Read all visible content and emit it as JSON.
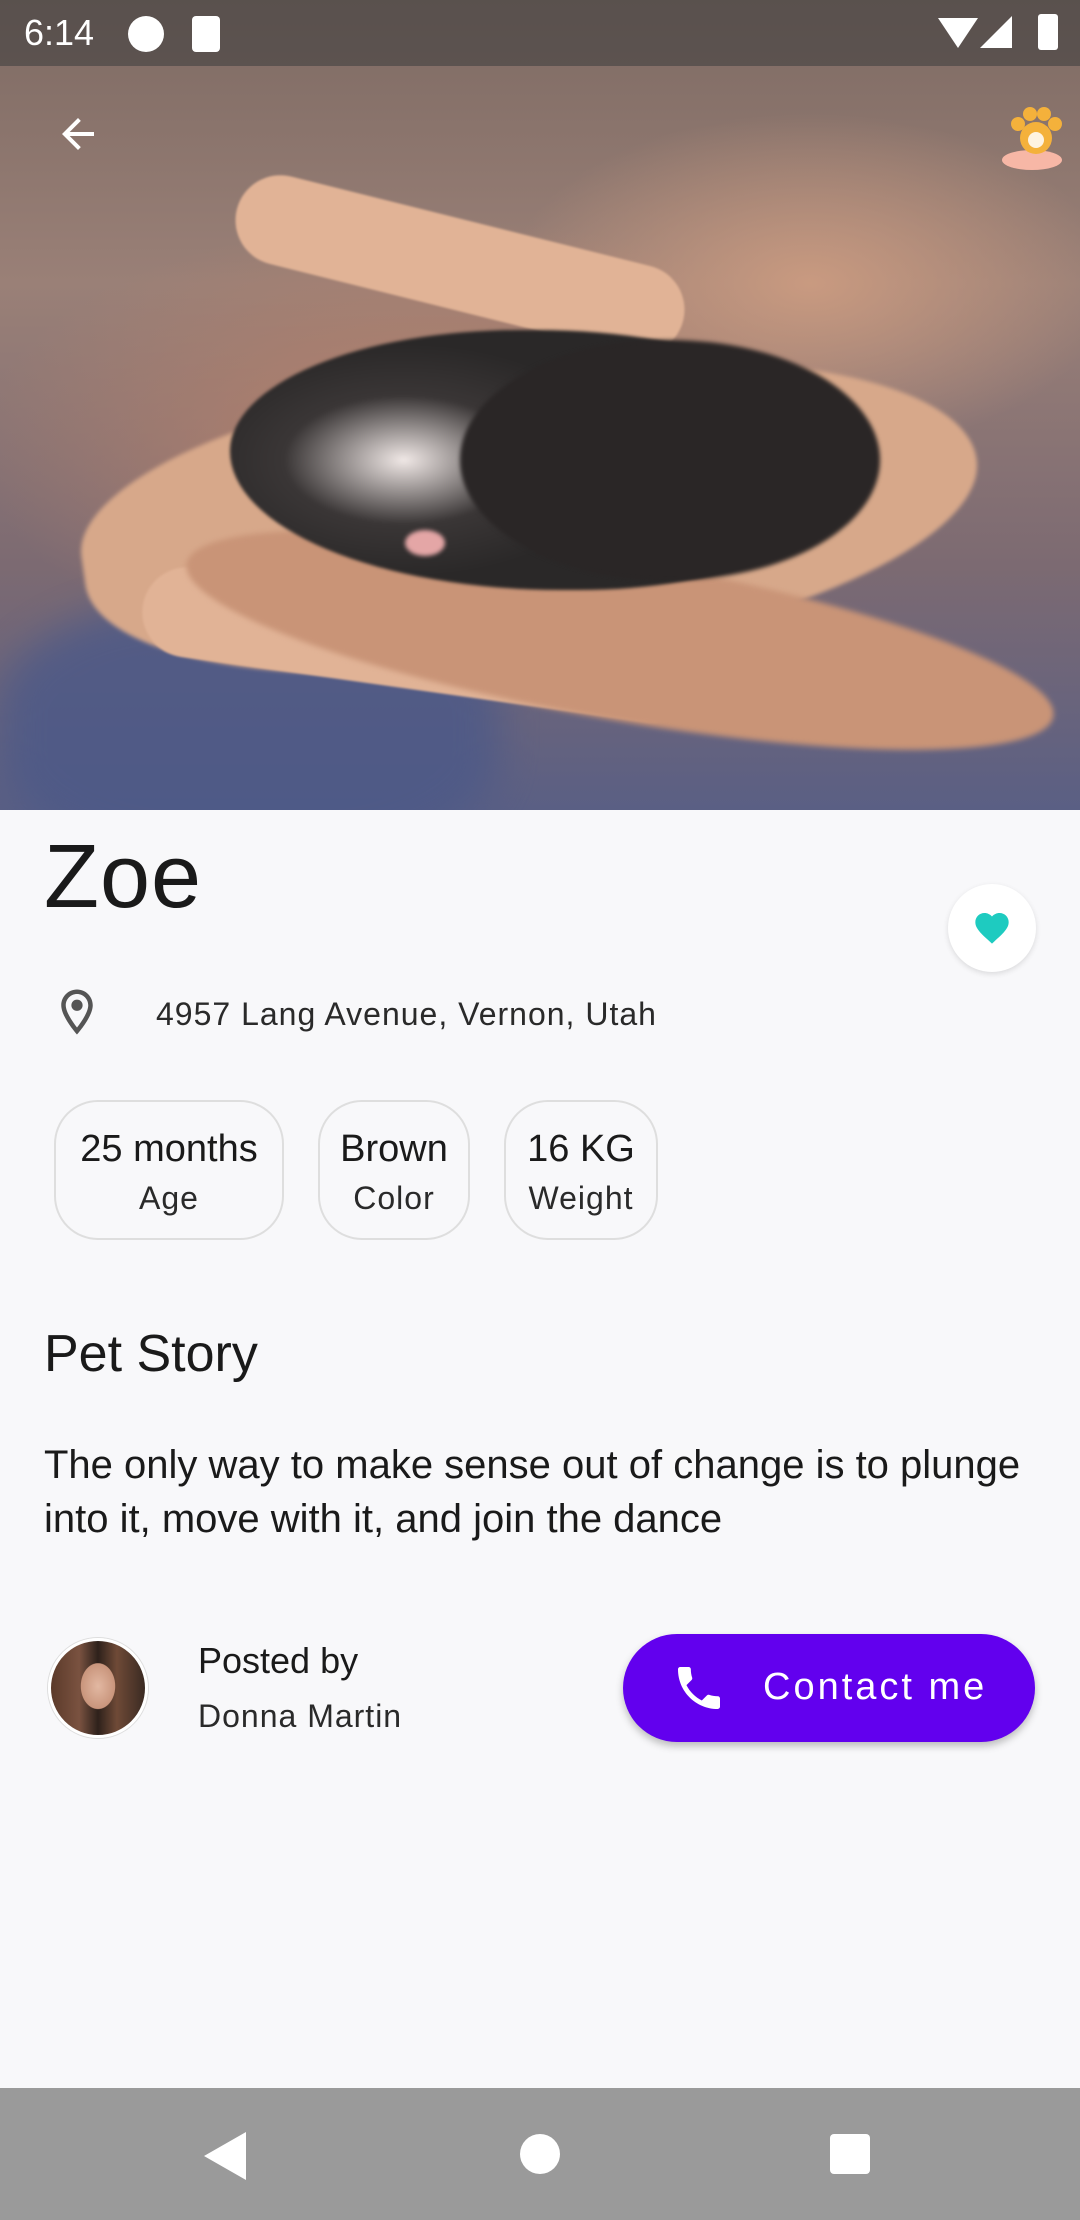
{
  "status_bar": {
    "time": "6:14"
  },
  "pet": {
    "name": "Zoe",
    "address": "4957  Lang Avenue, Vernon, Utah",
    "attributes": [
      {
        "value": "25 months",
        "label": "Age"
      },
      {
        "value": "Brown",
        "label": "Color"
      },
      {
        "value": "16 KG",
        "label": "Weight"
      }
    ],
    "favorite": true
  },
  "story": {
    "title": "Pet Story",
    "line1": "The only way to make sense out of change is to plunge",
    "line2": "into it, move with it, and join the dance"
  },
  "poster": {
    "label": "Posted by",
    "name": "Donna Martin"
  },
  "actions": {
    "contact_label": "Contact me"
  },
  "colors": {
    "accent": "#6200ee",
    "favorite": "#1ecbc0"
  }
}
